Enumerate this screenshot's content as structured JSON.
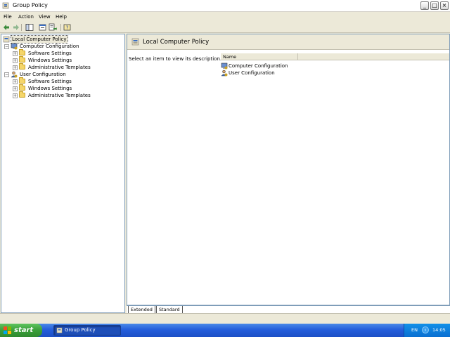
{
  "window": {
    "title": "Group Policy",
    "minimize": "_",
    "maximize": "□",
    "close": "×"
  },
  "menu": [
    "File",
    "Action",
    "View",
    "Help"
  ],
  "toolbar": {
    "icons": [
      "back-arrow-icon",
      "forward-arrow-icon",
      "show-hide-tree-icon",
      "properties-icon",
      "export-list-icon",
      "help-icon"
    ]
  },
  "tree": {
    "root": "Local Computer Policy",
    "computer": {
      "label": "Computer Configuration",
      "children": [
        "Software Settings",
        "Windows Settings",
        "Administrative Templates"
      ]
    },
    "user": {
      "label": "User Configuration",
      "children": [
        "Software Settings",
        "Windows Settings",
        "Administrative Templates"
      ]
    },
    "expander": "+",
    "collapser": "−"
  },
  "details": {
    "title": "Local Computer Policy",
    "description": "Select an item to view its description.",
    "column": "Name",
    "items": [
      "Computer Configuration",
      "User Configuration"
    ]
  },
  "tabs": [
    "Extended",
    "Standard"
  ],
  "taskbar": {
    "start": "start",
    "task": "Group Policy",
    "lang": "EN",
    "arrow": "‹",
    "clock": "14:05"
  },
  "colors": {
    "accent": "#245edb",
    "start": "#3a9e3a",
    "folder": "#f5d66a"
  }
}
